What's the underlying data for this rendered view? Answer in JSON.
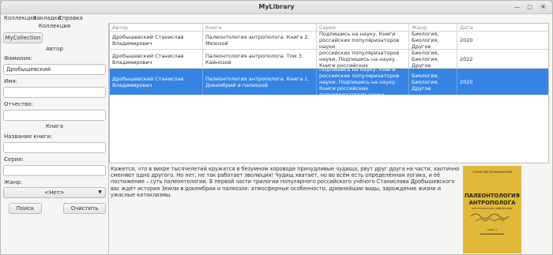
{
  "window": {
    "title": "MyLibrary"
  },
  "menu": [
    "Коллекция",
    "Закладки",
    "Справка"
  ],
  "sidebar": {
    "collection_title": "Коллекция",
    "collection_value": "MyCollection",
    "author_title": "Автор",
    "surname_label": "Фамилия:",
    "surname_value": "Дробышевский",
    "name_label": "Имя:",
    "name_value": "",
    "patronymic_label": "Отчество:",
    "patronymic_value": "",
    "book_title": "Книга",
    "bookname_label": "Название книги:",
    "bookname_value": "",
    "series_label": "Серия:",
    "series_value": "",
    "genre_label": "Жанр:",
    "genre_value": "<Нет>",
    "search_button": "Поиск",
    "clear_button": "Очистить"
  },
  "table": {
    "headers": [
      "Автор",
      "Книга",
      "Серия",
      "Жанр",
      "Дата"
    ],
    "rows": [
      {
        "author": "Дробышевский Станислав Владимирович",
        "book": "Палеонтология антрополога. Книга 2. Мезозой",
        "series": "Подпишись на науку. Книги российских популяризаторов науки",
        "genre": "Биология, Биология, Другое",
        "date": "2020"
      },
      {
        "author": "Дробышевский Станислав Владимирович",
        "book": "Палеонтология антрополога. Том 3. Кайнозой",
        "series": "Подпишись на науку. Книги российских популяризаторов науки, Подпишись на науку. Книги российских популяризаторов науки",
        "genre": "Биология, Биология, Другое",
        "date": "2022"
      },
      {
        "author": "Дробышевский Станислав Владимирович",
        "book": "Палеонтология антрополога. Книга 1. Докембрий и палеозой",
        "series": "Подпишись на науку. Книги российских популяризаторов науки, Подпишись на науку. Книги российских популяризаторов науки",
        "genre": "Биология, Биология, Другое",
        "date": "2020"
      }
    ]
  },
  "description": "Кажется, что в вихре тысячелетий кружатся в безумном хороводе причудливые чудища, рвут друг друга на части, хаотично сменяют одно другого. Но нет, не так работает эволюция! Чудищ хватает, но во всём есть определённая логика, и её постижение – суть палеонтологии. В первой части трилогии популярного российского учёного Станислава Дробышевского вас ждёт история Земли в докембрии и палеозое: атмосферные особенности, древнейшие виды, зарождение жизни и ужасные катаклизмы.",
  "cover": {
    "author": "СТАНИСЛАВ ДРОБЫШЕВСКИЙ",
    "title_line1": "ПАЛЕОНТОЛОГИЯ",
    "title_line2": "АНТРОПОЛОГА",
    "subtitle": "ВСЁ ЧТО МЫ ЗНАЕМ О ДРЕВНЕМ МИРЕ",
    "volume": "КНИГА 1"
  },
  "colors": {
    "selection": "#3584e4",
    "cover": "#e0b93b"
  }
}
